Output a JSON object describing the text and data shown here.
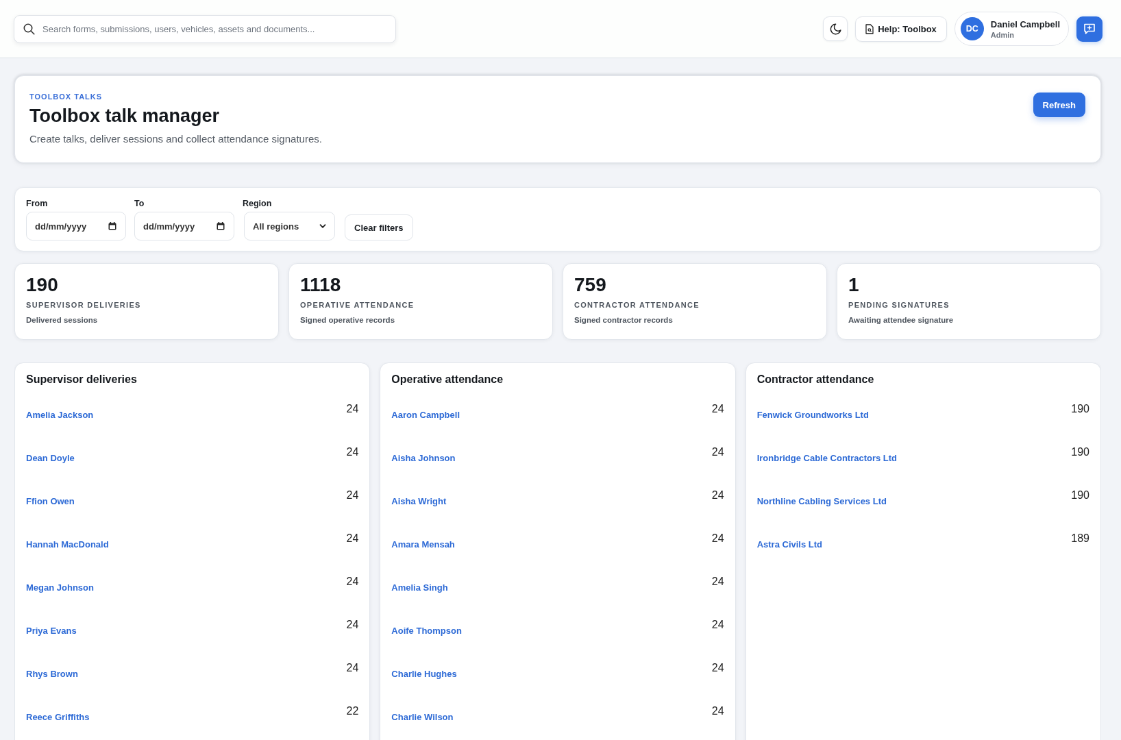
{
  "top_bar": {
    "search": {
      "placeholder": "Search forms, submissions, users, vehicles, assets and documents..."
    },
    "help_button": "Help: Toolbox",
    "user": {
      "initials": "DC",
      "name": "Daniel Campbell",
      "role": "Admin"
    }
  },
  "header": {
    "eyebrow": "TOOLBOX TALKS",
    "title": "Toolbox talk manager",
    "subtitle": "Create talks, deliver sessions and collect attendance signatures.",
    "refresh_button": "Refresh"
  },
  "filters": {
    "fields": [
      {
        "kind": "date",
        "label": "From",
        "placeholder": "dd/mm/yyyy"
      },
      {
        "kind": "date",
        "label": "To",
        "placeholder": "dd/mm/yyyy"
      },
      {
        "kind": "select",
        "label": "Region",
        "value": "All regions"
      }
    ],
    "clear_button": "Clear filters"
  },
  "stats": [
    {
      "value": "190",
      "label": "SUPERVISOR DELIVERIES",
      "description": "Delivered sessions"
    },
    {
      "value": "1118",
      "label": "OPERATIVE ATTENDANCE",
      "description": "Signed operative records"
    },
    {
      "value": "759",
      "label": "CONTRACTOR ATTENDANCE",
      "description": "Signed contractor records"
    },
    {
      "value": "1",
      "label": "PENDING SIGNATURES",
      "description": "Awaiting attendee signature"
    }
  ],
  "lists": [
    {
      "title": "Supervisor deliveries",
      "rows": [
        {
          "name": "Amelia Jackson",
          "count": "24"
        },
        {
          "name": "Dean Doyle",
          "count": "24"
        },
        {
          "name": "Ffion Owen",
          "count": "24"
        },
        {
          "name": "Hannah MacDonald",
          "count": "24"
        },
        {
          "name": "Megan Johnson",
          "count": "24"
        },
        {
          "name": "Priya Evans",
          "count": "24"
        },
        {
          "name": "Rhys Brown",
          "count": "24"
        },
        {
          "name": "Reece Griffiths",
          "count": "22"
        }
      ]
    },
    {
      "title": "Operative attendance",
      "rows": [
        {
          "name": "Aaron Campbell",
          "count": "24"
        },
        {
          "name": "Aisha Johnson",
          "count": "24"
        },
        {
          "name": "Aisha Wright",
          "count": "24"
        },
        {
          "name": "Amara Mensah",
          "count": "24"
        },
        {
          "name": "Amelia Singh",
          "count": "24"
        },
        {
          "name": "Aoife Thompson",
          "count": "24"
        },
        {
          "name": "Charlie Hughes",
          "count": "24"
        },
        {
          "name": "Charlie Wilson",
          "count": "24"
        }
      ]
    },
    {
      "title": "Contractor attendance",
      "rows": [
        {
          "name": "Fenwick Groundworks Ltd",
          "count": "190"
        },
        {
          "name": "Ironbridge Cable Contractors Ltd",
          "count": "190"
        },
        {
          "name": "Northline Cabling Services Ltd",
          "count": "190"
        },
        {
          "name": "Astra Civils Ltd",
          "count": "189"
        }
      ]
    }
  ]
}
